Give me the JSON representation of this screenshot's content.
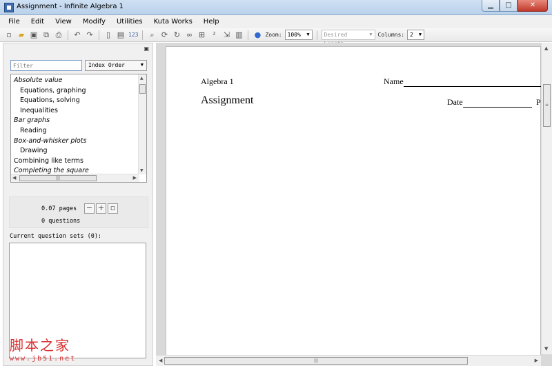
{
  "window": {
    "title": "Assignment - Infinite Algebra 1",
    "minimize": "▁",
    "maximize": "□",
    "close": "✕"
  },
  "menu": [
    "File",
    "Edit",
    "View",
    "Modify",
    "Utilities",
    "Kuta Works",
    "Help"
  ],
  "toolbar": {
    "number_label": "123",
    "zoom_label": "Zoom:",
    "zoom_value": "100%",
    "length_value": "Desired Length",
    "columns_label": "Columns:",
    "columns_value": "2"
  },
  "sidebar": {
    "filter_placeholder": "Filter",
    "order_value": "Index Order",
    "topics": [
      {
        "label": "Absolute value",
        "kind": "cat"
      },
      {
        "label": "Equations, graphing",
        "kind": "sub"
      },
      {
        "label": "Equations, solving",
        "kind": "sub"
      },
      {
        "label": "Inequalities",
        "kind": "sub"
      },
      {
        "label": "Bar graphs",
        "kind": "cat"
      },
      {
        "label": "Reading",
        "kind": "sub"
      },
      {
        "label": "Box-and-whisker plots",
        "kind": "cat"
      },
      {
        "label": "Drawing",
        "kind": "sub"
      },
      {
        "label": "Combining like terms",
        "kind": "plain"
      },
      {
        "label": "Completing the square",
        "kind": "cat"
      }
    ],
    "pages_text": "0.07 pages",
    "questions_text": "0 questions",
    "sets_label": "Current question sets (0):"
  },
  "document": {
    "course": "Algebra 1",
    "title": "Assignment",
    "name_label": "Name",
    "date_label": "Date",
    "period_label": "P"
  },
  "watermark": {
    "text": "脚本之家",
    "url": "www.jb51.net"
  }
}
